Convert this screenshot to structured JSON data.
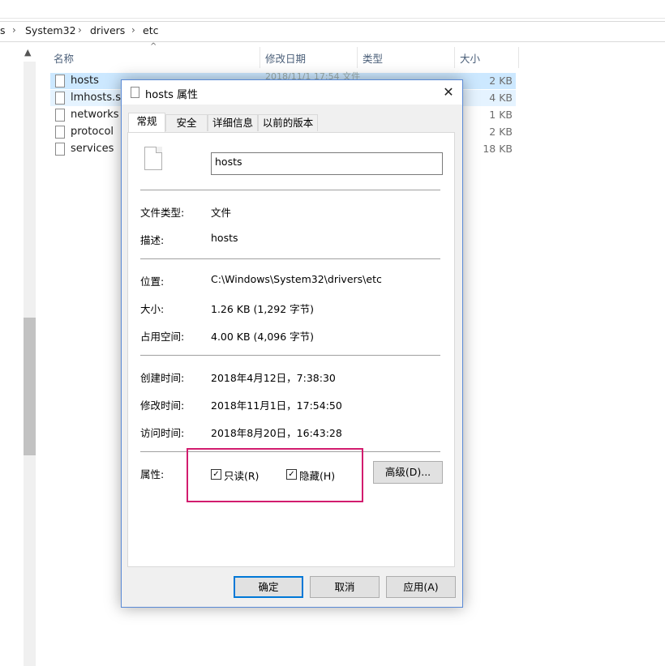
{
  "breadcrumb": [
    "s",
    "System32",
    "drivers",
    "etc"
  ],
  "columns": {
    "name": "名称",
    "modified": "修改日期",
    "type": "类型",
    "size": "大小"
  },
  "files": [
    {
      "name": "hosts",
      "size": "2 KB",
      "state": "selected"
    },
    {
      "name": "lmhosts.sam",
      "size": "4 KB",
      "state": "hover"
    },
    {
      "name": "networks",
      "size": "1 KB",
      "state": ""
    },
    {
      "name": "protocol",
      "size": "2 KB",
      "state": ""
    },
    {
      "name": "services",
      "size": "18 KB",
      "state": ""
    }
  ],
  "ghost_row_text": "2018/11/1 17:54   文件",
  "dialog": {
    "title": "hosts 属性",
    "close_glyph": "✕",
    "tabs": [
      "常规",
      "安全",
      "详细信息",
      "以前的版本"
    ],
    "active_tab": 0,
    "file_name": "hosts",
    "props": {
      "file_type": {
        "label": "文件类型:",
        "value": "文件"
      },
      "description": {
        "label": "描述:",
        "value": "hosts"
      },
      "location": {
        "label": "位置:",
        "value": "C:\\Windows\\System32\\drivers\\etc"
      },
      "size": {
        "label": "大小:",
        "value": "1.26 KB (1,292 字节)"
      },
      "size_on_disk": {
        "label": "占用空间:",
        "value": "4.00 KB (4,096 字节)"
      },
      "created": {
        "label": "创建时间:",
        "value": "2018年4月12日，7:38:30"
      },
      "modified": {
        "label": "修改时间:",
        "value": "2018年11月1日，17:54:50"
      },
      "accessed": {
        "label": "访问时间:",
        "value": "2018年8月20日，16:43:28"
      }
    },
    "attributes": {
      "label": "属性:",
      "readonly": {
        "label": "只读(R)",
        "checked": true
      },
      "hidden": {
        "label": "隐藏(H)",
        "checked": true
      },
      "advanced_button": "高级(D)..."
    },
    "buttons": {
      "ok": "确定",
      "cancel": "取消",
      "apply": "应用(A)"
    },
    "highlight_color": "#d21c6e"
  }
}
